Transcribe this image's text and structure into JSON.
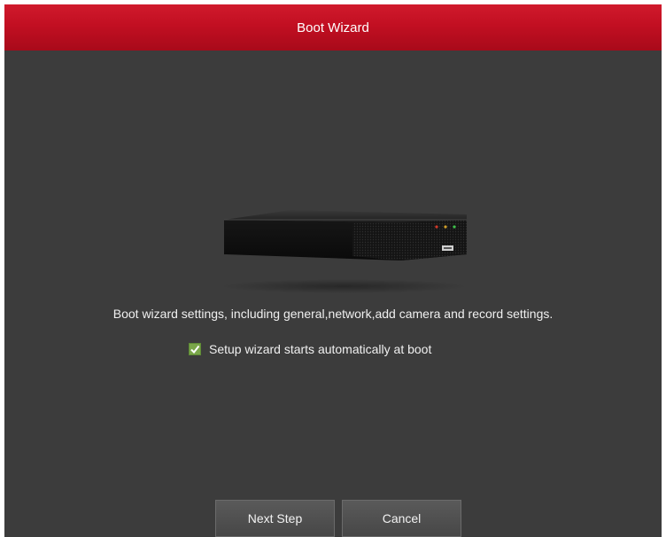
{
  "window": {
    "title": "Boot Wizard"
  },
  "main": {
    "device_image": "nvr-recorder-image",
    "description": "Boot wizard settings, including general,network,add camera and record settings.",
    "auto_start": {
      "label": "Setup wizard starts automatically at boot",
      "checked": true
    }
  },
  "buttons": {
    "next_label": "Next Step",
    "cancel_label": "Cancel"
  },
  "colors": {
    "titlebar": "#c20f22",
    "background": "#3c3c3c",
    "checkbox": "#7aa64a"
  }
}
